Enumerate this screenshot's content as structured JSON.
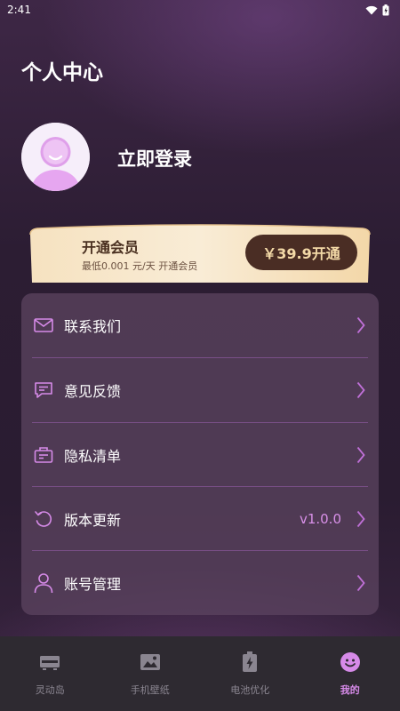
{
  "status_bar": {
    "time": "2:41"
  },
  "page_title": "个人中心",
  "profile": {
    "login_text": "立即登录"
  },
  "vip": {
    "title": "开通会员",
    "subtitle": "最低0.001 元/天  开通会员",
    "button_label": "￥39.9开通"
  },
  "menu": {
    "items": [
      {
        "label": "联系我们",
        "icon": "mail-icon",
        "value": ""
      },
      {
        "label": "意见反馈",
        "icon": "feedback-icon",
        "value": ""
      },
      {
        "label": "隐私清单",
        "icon": "privacy-list-icon",
        "value": ""
      },
      {
        "label": "版本更新",
        "icon": "refresh-icon",
        "value": "v1.0.0"
      },
      {
        "label": "账号管理",
        "icon": "user-icon",
        "value": ""
      }
    ]
  },
  "tabs": [
    {
      "label": "灵动岛",
      "icon": "island-icon",
      "active": false
    },
    {
      "label": "手机壁纸",
      "icon": "wallpaper-icon",
      "active": false
    },
    {
      "label": "电池优化",
      "icon": "battery-icon",
      "active": false
    },
    {
      "label": "我的",
      "icon": "smiley-icon",
      "active": true
    }
  ],
  "colors": {
    "accent": "#d68ae8",
    "vip_gold": "#f3d9a7",
    "vip_button": "#4a2d24",
    "tab_bar": "#2e2a31"
  }
}
